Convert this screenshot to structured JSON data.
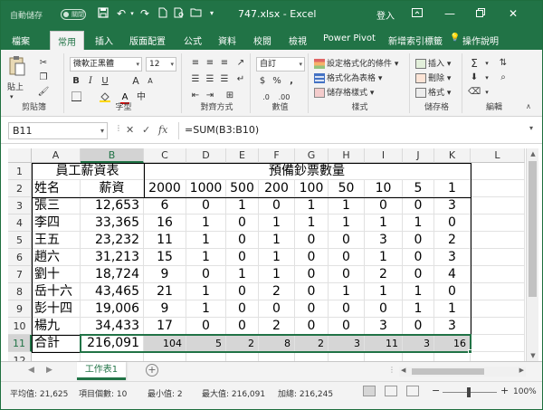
{
  "titlebar": {
    "autosave_label": "自動儲存",
    "autosave_state": "關閉",
    "title": "747.xlsx  -  Excel",
    "login": "登入",
    "qat_icons": [
      "save-icon",
      "undo-icon",
      "redo-icon",
      "new-file-icon",
      "print-preview-icon",
      "open-icon",
      "customize-qat-icon"
    ],
    "window_buttons": [
      "ribbon-display-icon",
      "minimize-icon",
      "restore-icon",
      "close-icon"
    ]
  },
  "tabs": [
    "檔案",
    "常用",
    "插入",
    "版面配置",
    "公式",
    "資料",
    "校閱",
    "檢視",
    "Power Pivot",
    "新增索引標籤",
    "操作說明"
  ],
  "active_tab": "常用",
  "ribbon": {
    "clipboard": {
      "paste": "貼上",
      "label": "剪貼簿"
    },
    "font": {
      "name": "微軟正黑體",
      "size": "12",
      "bold": "B",
      "italic": "I",
      "underline": "U",
      "grow": "A",
      "shrink": "A",
      "font_color": "A",
      "label": "字型"
    },
    "alignment": {
      "label": "對齊方式"
    },
    "number": {
      "format": "自訂",
      "percent": "%",
      "comma": ",",
      "label": "數值"
    },
    "styles": {
      "conditional": "設定格式化的條件",
      "table": "格式化為表格",
      "cell": "儲存格樣式",
      "label": "樣式"
    },
    "cells": {
      "insert": "插入",
      "delete": "刪除",
      "format": "格式",
      "label": "儲存格"
    },
    "editing": {
      "label": "編輯"
    },
    "accent_color": "#217346"
  },
  "formula_bar": {
    "name_box": "B11",
    "cancel": "✕",
    "enter": "✓",
    "fx": "fx",
    "formula": "=SUM(B3:B10)"
  },
  "columns": [
    "A",
    "B",
    "C",
    "D",
    "E",
    "F",
    "G",
    "H",
    "I",
    "J",
    "K",
    "L"
  ],
  "rows": [
    "1",
    "2",
    "3",
    "4",
    "5",
    "6",
    "7",
    "8",
    "9",
    "10",
    "11",
    "12"
  ],
  "sheet": {
    "header1": [
      "員工薪資表",
      "預備鈔票數量"
    ],
    "header2": [
      "姓名",
      "薪資",
      "2000",
      "1000",
      "500",
      "200",
      "100",
      "50",
      "10",
      "5",
      "1"
    ],
    "data": [
      [
        "張三",
        "12,653",
        "6",
        "0",
        "1",
        "0",
        "1",
        "1",
        "0",
        "0",
        "3"
      ],
      [
        "李四",
        "33,365",
        "16",
        "1",
        "0",
        "1",
        "1",
        "1",
        "1",
        "1",
        "0"
      ],
      [
        "王五",
        "23,232",
        "11",
        "1",
        "0",
        "1",
        "0",
        "0",
        "3",
        "0",
        "2"
      ],
      [
        "趙六",
        "31,213",
        "15",
        "1",
        "0",
        "1",
        "0",
        "0",
        "1",
        "0",
        "3"
      ],
      [
        "劉十",
        "18,724",
        "9",
        "0",
        "1",
        "1",
        "0",
        "0",
        "2",
        "0",
        "4"
      ],
      [
        "岳十六",
        "43,465",
        "21",
        "1",
        "0",
        "2",
        "0",
        "1",
        "1",
        "1",
        "0"
      ],
      [
        "彭十四",
        "19,006",
        "9",
        "1",
        "0",
        "0",
        "0",
        "0",
        "0",
        "1",
        "1"
      ],
      [
        "楊九",
        "34,433",
        "17",
        "0",
        "0",
        "2",
        "0",
        "0",
        "3",
        "0",
        "3"
      ]
    ],
    "total": [
      "合計",
      "216,091",
      "104",
      "5",
      "2",
      "8",
      "2",
      "3",
      "11",
      "3",
      "16"
    ]
  },
  "sheet_tab": "工作表1",
  "status_bar": {
    "average": "平均值: 21,625",
    "count": "項目個數: 10",
    "min": "最小值: 2",
    "max": "最大值: 216,091",
    "sum": "加總: 216,245",
    "zoom": "100%"
  }
}
